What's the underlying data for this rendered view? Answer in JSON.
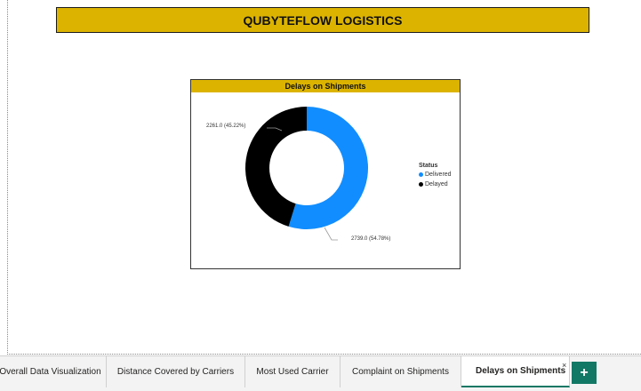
{
  "report": {
    "title": "QUBYTEFLOW LOGISTICS"
  },
  "visual": {
    "title": "Delays on Shipments",
    "legend_title": "Status"
  },
  "chart_data": {
    "type": "pie",
    "donut": true,
    "categories": [
      "Delivered",
      "Delayed"
    ],
    "values": [
      2739.0,
      2261.0
    ],
    "percentages": [
      54.78,
      45.22
    ],
    "labels": [
      "2739.0 (54.78%)",
      "2261.0 (45.22%)"
    ],
    "colors": [
      "#118dff",
      "#000000"
    ],
    "title": "Delays on Shipments",
    "legend_title": "Status",
    "legend_position": "right"
  },
  "tabs": [
    {
      "label": "Overall Data Visualization",
      "active": false
    },
    {
      "label": "Distance Covered by Carriers",
      "active": false
    },
    {
      "label": "Most Used Carrier",
      "active": false
    },
    {
      "label": "Complaint on Shipments",
      "active": false
    },
    {
      "label": "Delays on Shipments",
      "active": true
    }
  ],
  "tab_close_glyph": "×",
  "add_page_glyph": "+"
}
